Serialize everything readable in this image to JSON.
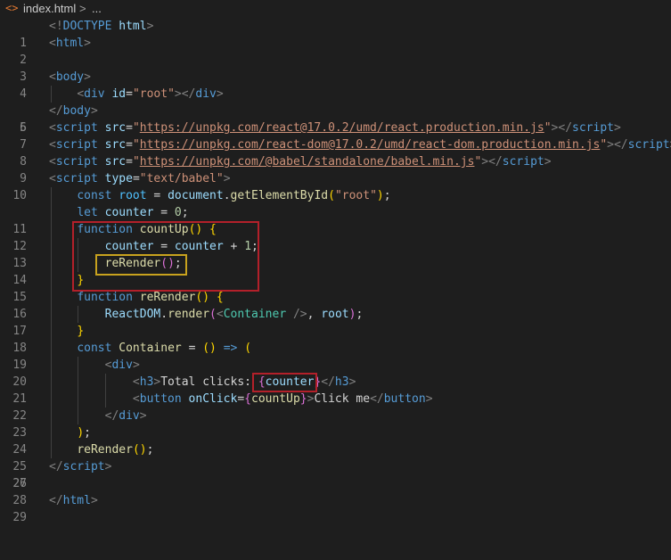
{
  "breadcrumb": {
    "icon": "html-file-icon",
    "file": "index.html",
    "separator": ">",
    "more": "..."
  },
  "editor": {
    "line_numbers": [
      "1",
      "2",
      "3",
      "4",
      "5",
      "6",
      "7",
      "8",
      "9",
      "10",
      "11",
      "12",
      "13",
      "14",
      "15",
      "16",
      "17",
      "18",
      "19",
      "20",
      "21",
      "22",
      "23",
      "24",
      "25",
      "26",
      "27",
      "28",
      "29"
    ],
    "tokens": {
      "doctype_open": "<!",
      "doctype_kw": "DOCTYPE",
      "doctype_html": "html",
      "doctype_close": ">",
      "html_tag": "html",
      "body_tag": "body",
      "div_tag": "div",
      "id_attr": "id",
      "root_str": "\"root\"",
      "script_tag": "script",
      "src_attr": "src",
      "type_attr": "type",
      "url_react": "https://unpkg.com/react@17.0.2/umd/react.production.min.js",
      "url_react_dom": "https://unpkg.com/react-dom@17.0.2/umd/react-dom.production.min.js",
      "url_babel": "https://unpkg.com/@babel/standalone/babel.min.js",
      "babel_str": "\"text/babel\"",
      "const_kw": "const",
      "let_kw": "let",
      "function_kw": "function",
      "root_var": "root",
      "document_var": "document",
      "getElementById_fn": "getElementById",
      "counter_var": "counter",
      "zero": "0",
      "one": "1",
      "countUp_fn": "countUp",
      "reRender_fn": "reRender",
      "reactdom_var": "ReactDOM",
      "render_fn": "render",
      "container_name": "Container",
      "h3_tag": "h3",
      "h3_text": "Total clicks: ",
      "button_tag": "button",
      "onclick_attr": "onClick",
      "button_text": "Click me"
    }
  },
  "colors": {
    "background": "#1e1e1e",
    "highlight_red": "#b3202a",
    "highlight_yellow": "#c8a21e"
  }
}
